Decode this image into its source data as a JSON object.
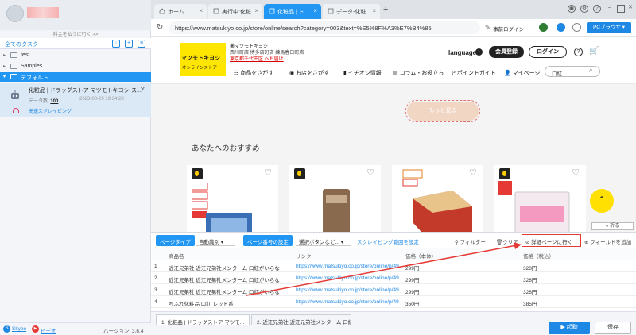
{
  "left": {
    "login_hint": "料金を払うに行く >>",
    "tasks_title": "全てのタスク",
    "tree": [
      {
        "label": "test"
      },
      {
        "label": "Samples"
      },
      {
        "label": "デフォルト"
      }
    ],
    "task": {
      "name": "化粧品 | ドラッグストア マツモトキヨシ-ス...",
      "data_label": "データ数:",
      "data_count": "100",
      "date": "2023-08-29 19:34:28",
      "speed": "高速スクレイピング"
    },
    "footer": {
      "skype": "Skype",
      "video": "ビデオ",
      "version": "バージョン: 3.6.4"
    }
  },
  "tabs": [
    {
      "label": "ホーム..."
    },
    {
      "label": "実行中:化粧..."
    },
    {
      "label": "化粧品 | ド..."
    },
    {
      "label": "データ-化粧..."
    }
  ],
  "address": {
    "url": "https://www.matsukiyo.co.jp/store/online/search?category=003&text=%E5%8F%A3%E7%B4%85",
    "pre_login": "事前ログイン",
    "pc_browser": "PCブラウザ"
  },
  "site": {
    "logo": "マツモトキヨシ",
    "logo_sub": "オンラインストア",
    "store_name": "薬マツモトキヨシ",
    "store_addr": "西川町店 博多店町店 練馬春日町店",
    "store_link": "東京都千代田区 へお届け",
    "language": "language",
    "register": "会員登録",
    "login": "ログイン",
    "nav": [
      "商品をさがす",
      "お店をさがす",
      "イチオシ情報",
      "コラム・お役立ち",
      "ポイントガイド",
      "マイページ"
    ],
    "search_value": "口紅",
    "more": "もっと見る",
    "rec_title": "あなたへのおすすめ",
    "fold": "折る"
  },
  "panel": {
    "page_type_label": "ページタイプ",
    "page_type_value": "自動識別",
    "page_num_label": "ページ番号の設定",
    "page_num_value": "選択ボタンなど...",
    "scrape_range": "スクレイピング範囲を設定",
    "filter": "フィルター",
    "clear": "クリア",
    "goto_detail": "詳細ページに行く",
    "add_field": "フィールドを追加",
    "columns": [
      "商品名",
      "リンク",
      "価格（本体）",
      "価格（税込）"
    ],
    "rows": [
      {
        "idx": "1",
        "name": "近江兄弟社 近江兄弟社メンターム 口紅がいらな...",
        "link": "https://www.matsukiyo.co.jp/store/online/p/4987...",
        "price1": "299円",
        "price2": "328円"
      },
      {
        "idx": "2",
        "name": "近江兄弟社 近江兄弟社メンターム 口紅がいらな...",
        "link": "https://www.matsukiyo.co.jp/store/online/p/4987...",
        "price1": "299円",
        "price2": "328円"
      },
      {
        "idx": "3",
        "name": "近江兄弟社 近江兄弟社メンターム 口紅がいらな...",
        "link": "https://www.matsukiyo.co.jp/store/online/p/4987...",
        "price1": "299円",
        "price2": "328円"
      },
      {
        "idx": "4",
        "name": "ちふれ化粧品 口紅 レッド系",
        "link": "https://www.matsukiyo.co.jp/store/online/p/4974...",
        "price1": "350円",
        "price2": "385円"
      }
    ],
    "bottom_tabs": [
      "1. 化粧品 | ドラッグストア マツモ...",
      "2. 近江兄弟社 近江兄弟社メンターム 口紅がいら..."
    ],
    "run": "起動",
    "save": "保存"
  },
  "colors": {
    "accent": "#2196f3",
    "highlight": "#e53935",
    "logo": "#ffe600"
  }
}
